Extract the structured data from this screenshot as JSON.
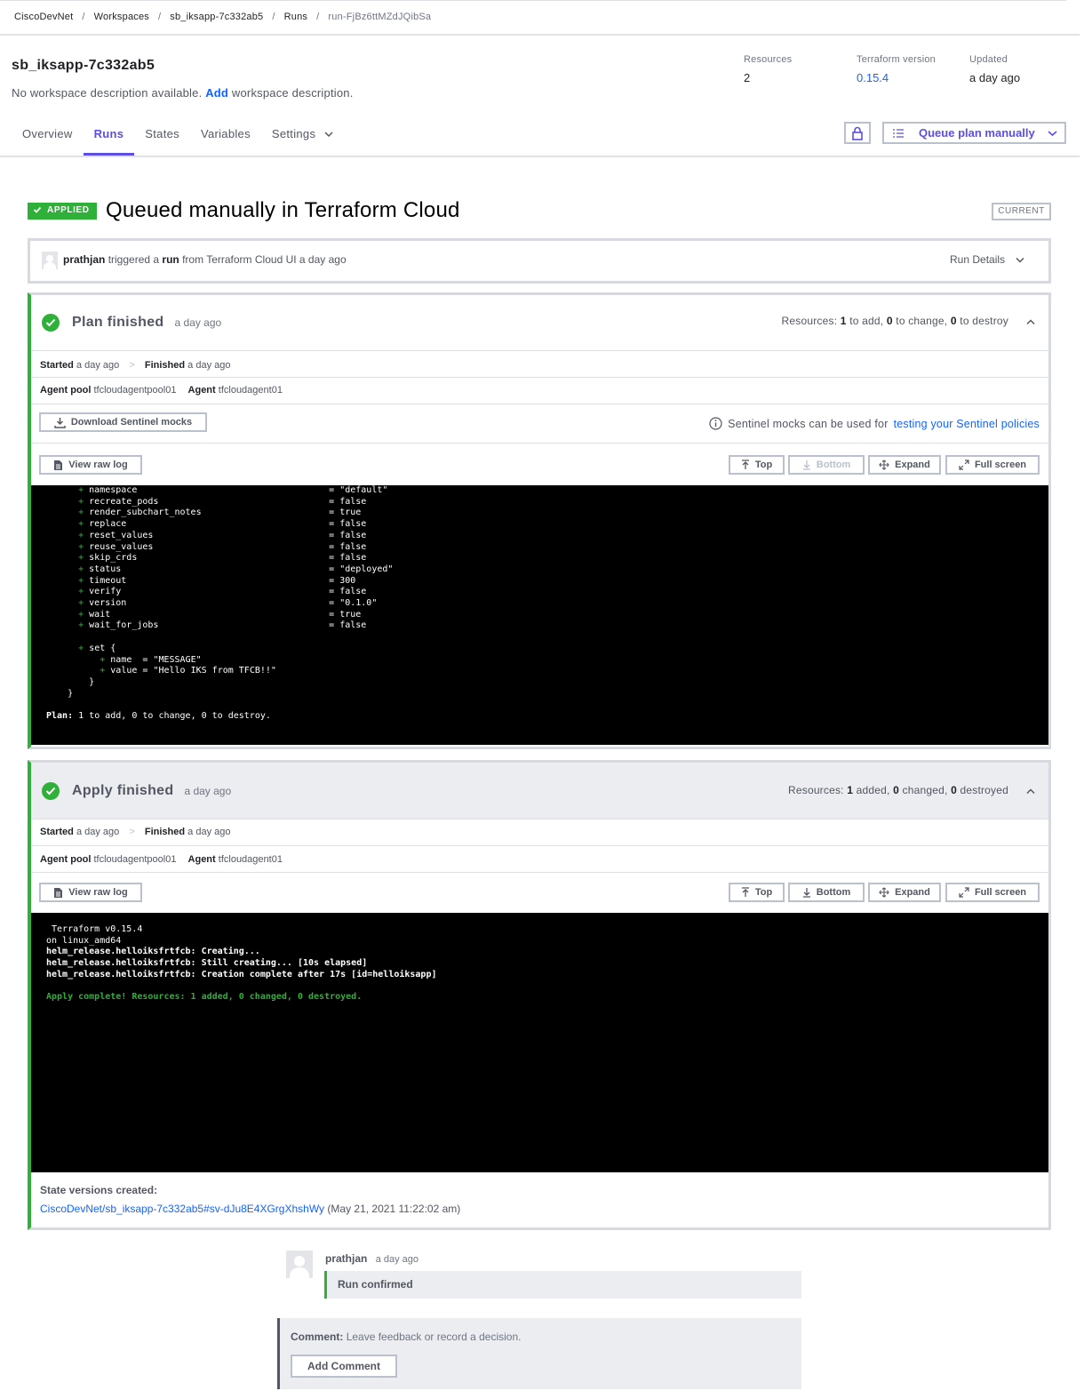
{
  "breadcrumb": {
    "org": "CiscoDevNet",
    "workspaces": "Workspaces",
    "workspace": "sb_iksapp-7c332ab5",
    "runs": "Runs",
    "run_id": "run-FjBz6ttMZdJQibSa"
  },
  "workspace": {
    "name": "sb_iksapp-7c332ab5",
    "desc_prefix": "No workspace description available.",
    "desc_link": "Add",
    "desc_suffix": "workspace description."
  },
  "meta": {
    "resources_label": "Resources",
    "resources_value": "2",
    "tf_label": "Terraform version",
    "tf_value": "0.15.4",
    "updated_label": "Updated",
    "updated_value": "a day ago"
  },
  "tabs": [
    "Overview",
    "Runs",
    "States",
    "Variables",
    "Settings"
  ],
  "queue_button": "Queue plan manually",
  "run": {
    "status": "APPLIED",
    "title": "Queued manually in Terraform Cloud",
    "current": "CURRENT"
  },
  "trigger": {
    "user": "prathjan",
    "t1": "triggered a",
    "run_word": "run",
    "t2": "from Terraform Cloud UI a day ago",
    "details": "Run Details"
  },
  "plan": {
    "title": "Plan finished",
    "time": "a day ago",
    "res_prefix": "Resources:",
    "add_n": "1",
    "add_t": "to add,",
    "chg_n": "0",
    "chg_t": "to change,",
    "del_n": "0",
    "del_t": "to destroy",
    "started_lbl": "Started",
    "started_val": "a day ago",
    "finished_lbl": "Finished",
    "finished_val": "a day ago",
    "pool_lbl": "Agent pool",
    "pool_val": "tfcloudagentpool01",
    "agent_lbl": "Agent",
    "agent_val": "tfcloudagent01",
    "download": "Download Sentinel mocks",
    "mocks_text": "Sentinel mocks can be used for",
    "mocks_link": "testing your Sentinel policies",
    "raw_log": "View raw log",
    "top": "Top",
    "bottom": "Bottom",
    "expand": "Expand",
    "fullscreen": "Full screen",
    "log": [
      {
        "p": "+",
        "k": "namespace",
        "v": "= \"default\""
      },
      {
        "p": "+",
        "k": "recreate_pods",
        "v": "= false"
      },
      {
        "p": "+",
        "k": "render_subchart_notes",
        "v": "= true"
      },
      {
        "p": "+",
        "k": "replace",
        "v": "= false"
      },
      {
        "p": "+",
        "k": "reset_values",
        "v": "= false"
      },
      {
        "p": "+",
        "k": "reuse_values",
        "v": "= false"
      },
      {
        "p": "+",
        "k": "skip_crds",
        "v": "= false"
      },
      {
        "p": "+",
        "k": "status",
        "v": "= \"deployed\""
      },
      {
        "p": "+",
        "k": "timeout",
        "v": "= 300"
      },
      {
        "p": "+",
        "k": "verify",
        "v": "= false"
      },
      {
        "p": "+",
        "k": "version",
        "v": "= \"0.1.0\""
      },
      {
        "p": "+",
        "k": "wait",
        "v": "= true"
      },
      {
        "p": "+",
        "k": "wait_for_jobs",
        "v": "= false"
      }
    ],
    "set_line": "set {",
    "set_name": "name  = \"MESSAGE\"",
    "set_value": "value = \"Hello IKS from TFCB!!\"",
    "close_inner": "}",
    "close_outer": "}",
    "summary_label": "Plan:",
    "summary_text": "1 to add, 0 to change, 0 to destroy."
  },
  "apply": {
    "title": "Apply finished",
    "time": "a day ago",
    "res_prefix": "Resources:",
    "add_n": "1",
    "add_t": "added,",
    "chg_n": "0",
    "chg_t": "changed,",
    "del_n": "0",
    "del_t": "destroyed",
    "started_lbl": "Started",
    "started_val": "a day ago",
    "finished_lbl": "Finished",
    "finished_val": "a day ago",
    "pool_lbl": "Agent pool",
    "pool_val": "tfcloudagentpool01",
    "agent_lbl": "Agent",
    "agent_val": "tfcloudagent01",
    "raw_log": "View raw log",
    "top": "Top",
    "bottom": "Bottom",
    "expand": "Expand",
    "fullscreen": "Full screen",
    "log1": " Terraform v0.15.4",
    "log2": "on linux_amd64",
    "log3": "helm_release.helloiksfrtfcb: Creating...",
    "log4": "helm_release.helloiksfrtfcb: Still creating... [10s elapsed]",
    "log5": "helm_release.helloiksfrtfcb: Creation complete after 17s [id=helloiksapp]",
    "log6": "Apply complete! Resources: 1 added, 0 changed, 0 destroyed.",
    "state_label": "State versions created:",
    "state_link": "CiscoDevNet/sb_iksapp-7c332ab5#sv-dJu8E4XGrgXhshWy",
    "state_date": "(May 21, 2021 11:22:02 am)"
  },
  "confirm": {
    "user": "prathjan",
    "time": "a day ago",
    "text": "Run confirmed"
  },
  "comment": {
    "label": "Comment:",
    "hint": "Leave feedback or record a decision.",
    "button": "Add Comment"
  },
  "colors": {
    "accent": "#5c4ee5",
    "success": "#2eb039",
    "link": "#1563ff"
  }
}
